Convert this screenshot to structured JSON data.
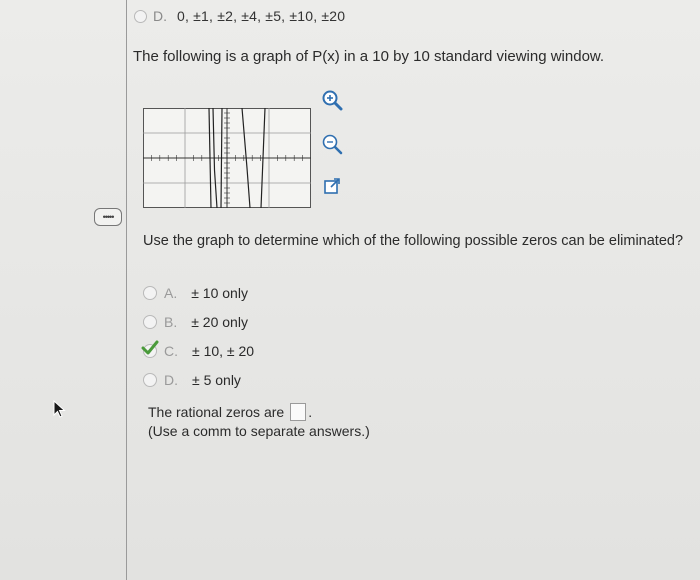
{
  "previous_option": {
    "letter": "D.",
    "text": "0, ±1, ±2, ±4, ±5, ±10, ±20"
  },
  "intro": "The following is a graph of P(x) in a 10 by 10 standard viewing window.",
  "tools": [
    "zoom-in-icon",
    "zoom-out-icon",
    "open-external-icon"
  ],
  "question": "Use the graph to determine which of the following possible zeros can be eliminated?",
  "choices": [
    {
      "letter": "A.",
      "text": "± 10 only",
      "selected": false
    },
    {
      "letter": "B.",
      "text": "± 20 only",
      "selected": false
    },
    {
      "letter": "C.",
      "text": "± 10,  ± 20",
      "selected": true
    },
    {
      "letter": "D.",
      "text": "± 5 only",
      "selected": false
    }
  ],
  "answer": {
    "prefix": "The rational zeros are",
    "suffix": ".",
    "value": "",
    "note": "(Use a comm to separate answers.)"
  },
  "more_tab_label": "•••••",
  "colors": {
    "check": "#4a9a3a",
    "accent": "#2f6fb0"
  }
}
